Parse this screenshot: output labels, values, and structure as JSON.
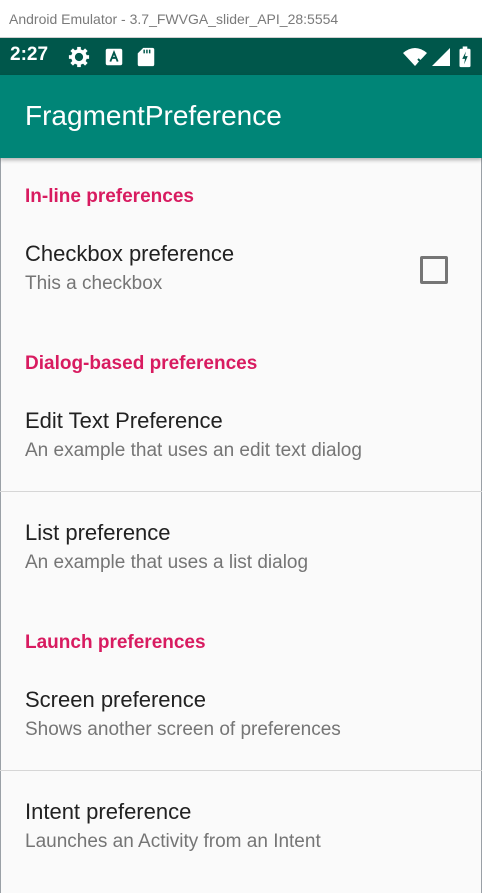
{
  "window": {
    "title": "Android Emulator - 3.7_FWVGA_slider_API_28:5554"
  },
  "status_bar": {
    "time": "2:27",
    "left_icons": [
      "settings-icon",
      "text-a-icon",
      "sd-card-icon"
    ],
    "right_icons": [
      "wifi-icon",
      "signal-icon",
      "battery-icon"
    ]
  },
  "app_bar": {
    "title": "FragmentPreference"
  },
  "categories": {
    "inline": "In-line preferences",
    "dialog": "Dialog-based preferences",
    "launch": "Launch preferences"
  },
  "preferences": {
    "checkbox": {
      "title": "Checkbox preference",
      "summary": "This a checkbox",
      "checked": false
    },
    "edit_text": {
      "title": "Edit Text Preference",
      "summary": "An example that uses an edit text dialog"
    },
    "list": {
      "title": "List preference",
      "summary": "An example that uses a list dialog"
    },
    "screen": {
      "title": "Screen preference",
      "summary": "Shows another screen of preferences"
    },
    "intent": {
      "title": "Intent preference",
      "summary": "Launches an Activity from an Intent"
    }
  },
  "colors": {
    "status_bar": "#00574b",
    "app_bar": "#008577",
    "category_accent": "#d81b60",
    "background": "#fafafa"
  }
}
